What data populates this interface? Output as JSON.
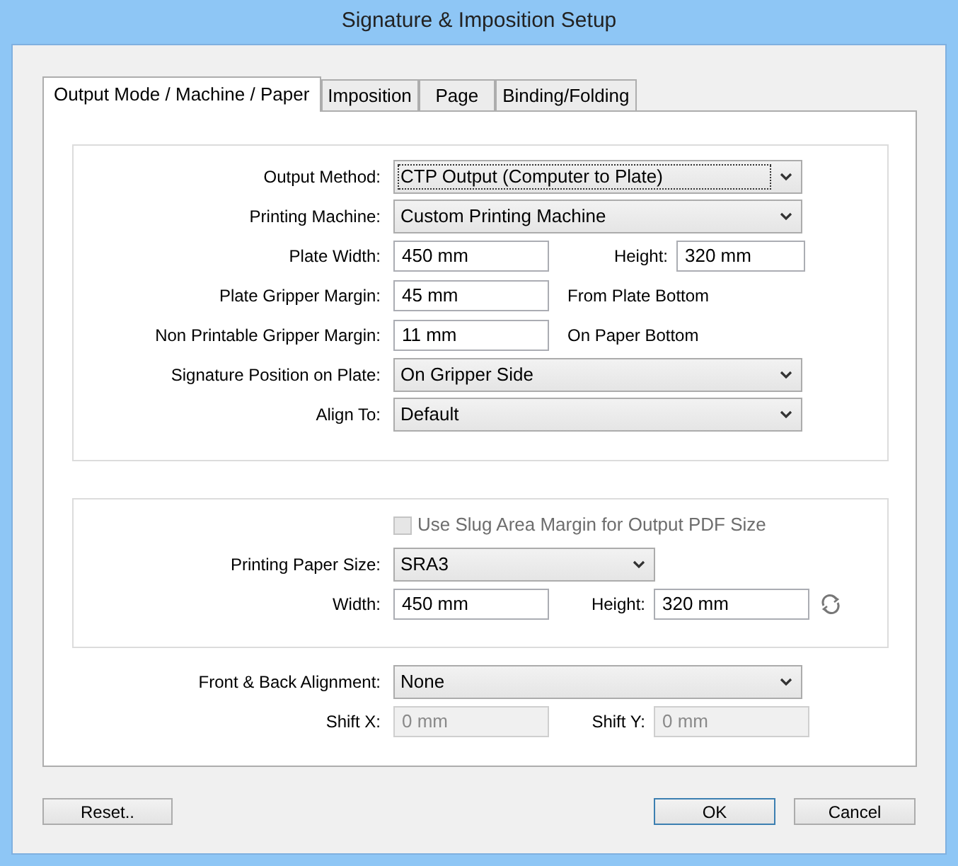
{
  "window": {
    "title": "Signature & Imposition Setup"
  },
  "tabs": [
    {
      "label": "Output Mode / Machine / Paper",
      "selected": true
    },
    {
      "label": "Imposition",
      "selected": false
    },
    {
      "label": "Page",
      "selected": false
    },
    {
      "label": "Binding/Folding",
      "selected": false
    }
  ],
  "machine_group": {
    "rows": [
      {
        "kind": "select",
        "label": "Output Method:",
        "value": "CTP Output (Computer to Plate)",
        "focused": true
      },
      {
        "kind": "select",
        "label": "Printing Machine:",
        "value": "Custom Printing Machine",
        "focused": false
      },
      {
        "kind": "pair",
        "label": "Plate Width:",
        "value": "450 mm",
        "label_2": "Height:",
        "value_2": "320 mm"
      },
      {
        "kind": "note",
        "label": "Plate Gripper Margin:",
        "value": "45 mm",
        "note": "From Plate Bottom"
      },
      {
        "kind": "note",
        "label": "Non Printable Gripper Margin:",
        "value": "11 mm",
        "note": "On Paper Bottom"
      },
      {
        "kind": "select",
        "label": "Signature Position on Plate:",
        "value": "On Gripper Side",
        "focused": false
      },
      {
        "kind": "select",
        "label": "Align To:",
        "value": "Default",
        "focused": false
      }
    ]
  },
  "paper_group": {
    "rows": [
      {
        "kind": "checkbox",
        "label": "Use Slug Area Margin for Output PDF Size",
        "checked": false,
        "disabled": true
      },
      {
        "kind": "select_short",
        "label": "Printing Paper Size:",
        "value": "SRA3",
        "focused": false
      },
      {
        "kind": "pair_swap",
        "label": "Width:",
        "value": "450 mm",
        "label_2": "Height:",
        "value_2": "320 mm"
      }
    ]
  },
  "alignment": {
    "rows": [
      {
        "kind": "select",
        "label": "Front & Back Alignment:",
        "value": "None",
        "focused": false
      },
      {
        "kind": "pair_disabled",
        "label": "Shift X:",
        "value": "0 mm",
        "label_2": "Shift Y:",
        "value_2": "0 mm"
      }
    ]
  },
  "buttons": [
    {
      "label": "Reset..",
      "default": false
    },
    {
      "label": "OK",
      "default": true
    },
    {
      "label": "Cancel",
      "default": false
    }
  ]
}
